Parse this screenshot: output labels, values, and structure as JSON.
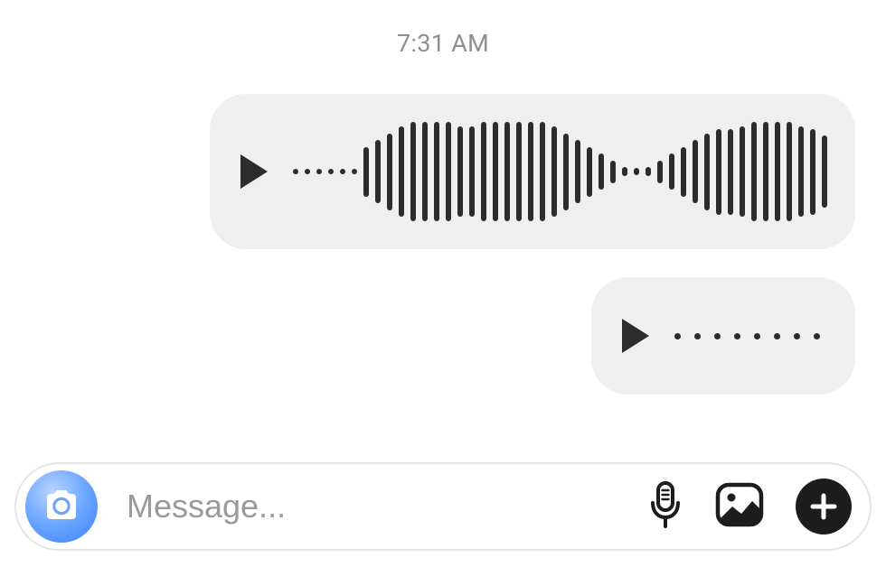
{
  "timestamp": "7:31 AM",
  "messages": [
    {
      "type": "voice",
      "waveform": [
        0,
        0,
        0,
        0,
        0,
        0,
        55,
        70,
        85,
        100,
        110,
        110,
        110,
        110,
        100,
        100,
        110,
        110,
        110,
        110,
        110,
        110,
        100,
        85,
        70,
        55,
        40,
        25,
        10,
        8,
        10,
        25,
        40,
        55,
        70,
        85,
        95,
        95,
        100,
        110,
        110,
        110,
        110,
        100,
        95,
        80
      ],
      "side": "right"
    },
    {
      "type": "voice",
      "waveform": [
        0,
        0,
        0,
        0,
        0,
        0,
        0,
        0
      ],
      "side": "right"
    }
  ],
  "composer": {
    "placeholder": "Message..."
  },
  "icons": {
    "camera": "camera-icon",
    "mic": "mic-icon",
    "gallery": "gallery-icon",
    "add": "add-icon",
    "play": "play-icon"
  }
}
